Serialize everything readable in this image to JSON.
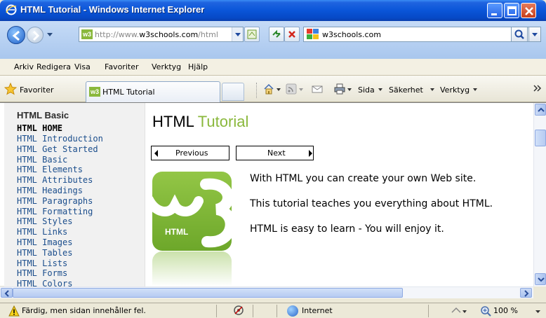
{
  "window": {
    "title": "HTML Tutorial - Windows Internet Explorer"
  },
  "address": {
    "url_gray": "http://www.",
    "url_domain": "w3schools.com",
    "url_rest": "/html"
  },
  "search": {
    "text": "w3schools.com"
  },
  "menu": [
    "Arkiv",
    "Redigera",
    "Visa",
    "Favoriter",
    "Verktyg",
    "Hjälp"
  ],
  "favbar": {
    "favorites_label": "Favoriter",
    "tab_label": "HTML Tutorial",
    "commands": {
      "page": "Sida",
      "security": "Säkerhet",
      "tools": "Verktyg"
    }
  },
  "sidebar": {
    "heading": "HTML Basic",
    "current": "HTML HOME",
    "items": [
      "HTML Introduction",
      "HTML Get Started",
      "HTML Basic",
      "HTML Elements",
      "HTML Attributes",
      "HTML Headings",
      "HTML Paragraphs",
      "HTML Formatting",
      "HTML Styles",
      "HTML Links",
      "HTML Images",
      "HTML Tables",
      "HTML Lists",
      "HTML Forms",
      "HTML Colors"
    ]
  },
  "main": {
    "title_part1": "HTML ",
    "title_part2": "Tutorial",
    "prev_label": "Previous",
    "next_label": "Next",
    "logo_text": "HTML",
    "paragraphs": [
      "With HTML you can create your own Web site.",
      "This tutorial teaches you everything about HTML.",
      "HTML is easy to learn - You will enjoy it."
    ]
  },
  "status": {
    "message": "Färdig, men sidan innehåller fel.",
    "zone": "Internet",
    "zoom": "100 %"
  },
  "colors": {
    "titlebar": "#0a55d8",
    "w3_green": "#8ab83c",
    "link": "#1a4d8c"
  }
}
